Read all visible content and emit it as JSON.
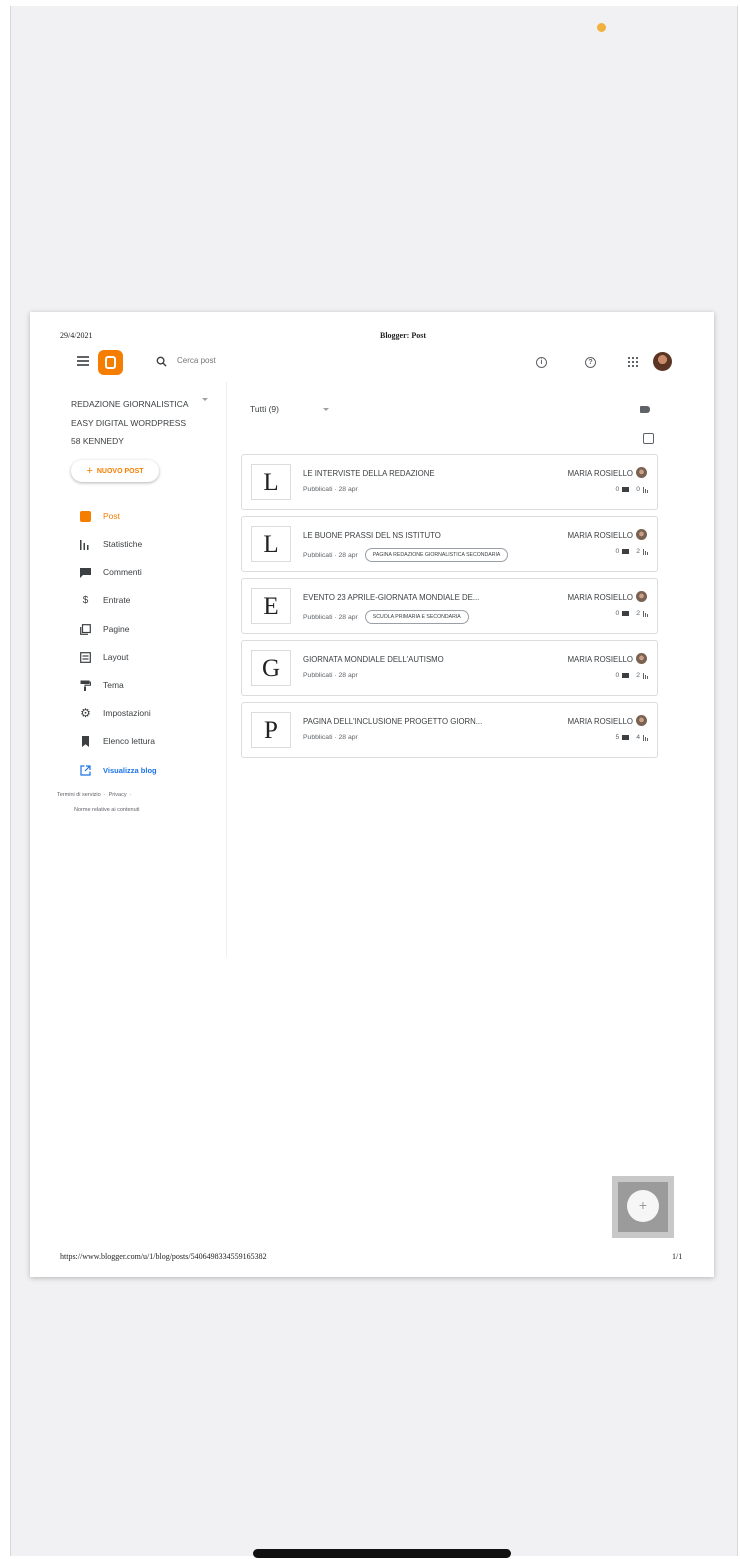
{
  "pdf_header": {
    "date": "29/4/2021",
    "title": "Blogger: Post"
  },
  "pdf_footer": {
    "url": "https://www.blogger.com/u/1/blog/posts/5406498334559165382",
    "pages": "1/1"
  },
  "topbar": {
    "search_placeholder": "Cerca post",
    "icons": [
      "menu-icon",
      "blogger-logo",
      "search-icon",
      "info-icon",
      "help-icon",
      "apps-icon",
      "avatar"
    ]
  },
  "sidebar": {
    "blog_name_lines": [
      "REDAZIONE GIORNALISTICA",
      "EASY DIGITAL WORDPRESS",
      "58 KENNEDY"
    ],
    "new_post_label": "NUOVO POST",
    "nav": [
      {
        "label": "Post",
        "icon": "post-icon",
        "active": true
      },
      {
        "label": "Statistiche",
        "icon": "stats-icon"
      },
      {
        "label": "Commenti",
        "icon": "comment-icon"
      },
      {
        "label": "Entrate",
        "icon": "dollar-icon"
      },
      {
        "label": "Pagine",
        "icon": "pages-icon"
      },
      {
        "label": "Layout",
        "icon": "layout-icon"
      },
      {
        "label": "Tema",
        "icon": "paint-roller-icon"
      },
      {
        "label": "Impostazioni",
        "icon": "gear-icon"
      },
      {
        "label": "Elenco lettura",
        "icon": "bookmark-icon"
      },
      {
        "label": "Visualizza blog",
        "icon": "external-link-icon"
      }
    ],
    "footer": {
      "terms": "Termini di servizio",
      "privacy": "Privacy",
      "content_policy": "Norme relative ai contenuti"
    }
  },
  "main": {
    "filter_label": "Tutti (9)",
    "posts": [
      {
        "letter": "L",
        "title": "LE INTERVISTE DELLA REDAZIONE",
        "status": "Pubblicati · 28 apr",
        "tag": "",
        "author": "MARIA ROSIELLO",
        "comments": "0",
        "views": "0"
      },
      {
        "letter": "L",
        "title": "LE BUONE PRASSI DEL NS ISTITUTO",
        "status": "Pubblicati · 28 apr",
        "tag": "PAGINA REDAZIONE GIORNALISTICA SECONDARIA",
        "author": "MARIA ROSIELLO",
        "comments": "0",
        "views": "2"
      },
      {
        "letter": "E",
        "title": "EVENTO 23 APRILE-GIORNATA MONDIALE DE...",
        "status": "Pubblicati · 28 apr",
        "tag": "SCUOLA PRIMARIA E SECONDARIA",
        "author": "MARIA ROSIELLO",
        "comments": "0",
        "views": "2"
      },
      {
        "letter": "G",
        "title": "GIORNATA MONDIALE DELL'AUTISMO",
        "status": "Pubblicati · 28 apr",
        "tag": "",
        "author": "MARIA ROSIELLO",
        "comments": "0",
        "views": "2"
      },
      {
        "letter": "P",
        "title": "PAGINA DELL'INCLUSIONE PROGETTO GIORN...",
        "status": "Pubblicati · 28 apr",
        "tag": "",
        "author": "MARIA ROSIELLO",
        "comments": "5",
        "views": "4"
      }
    ]
  },
  "fab": {
    "label": "+"
  }
}
